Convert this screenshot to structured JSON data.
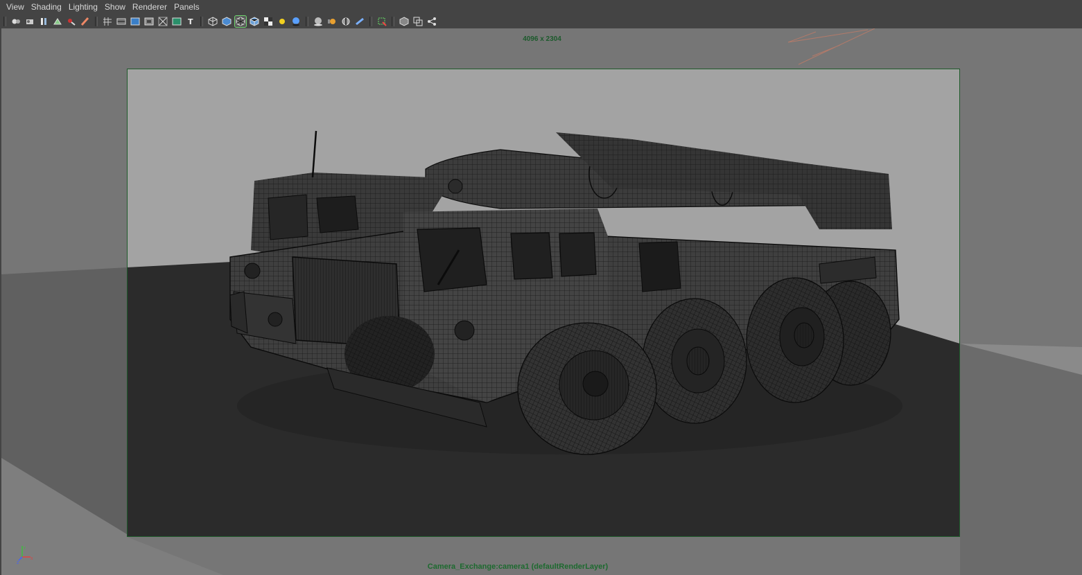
{
  "menu": [
    "View",
    "Shading",
    "Lighting",
    "Show",
    "Renderer",
    "Panels"
  ],
  "toolbar_groups": [
    [
      "camera-select-icon",
      "camera-attributes-icon",
      "bookmark-icon",
      "image-plane-icon",
      "2d-pan-zoom-icon",
      "grease-pencil-icon"
    ],
    [
      "grid-icon",
      "film-gate-icon",
      "resolution-gate-icon",
      "gate-mask-icon",
      "field-chart-icon",
      "safe-action-icon",
      "safe-title-icon"
    ],
    [
      "wireframe-icon",
      "smooth-shade-icon",
      "wireframe-on-shaded-icon",
      "flat-shade-icon",
      "textured-icon",
      "use-all-lights-icon",
      "shadows-icon"
    ],
    [
      "screen-space-ao-icon",
      "motion-blur-icon",
      "depth-of-field-icon",
      "anti-aliasing-icon"
    ],
    [
      "isolate-select-icon"
    ],
    [
      "xray-icon",
      "xray-active-components-icon",
      "xray-joints-icon"
    ]
  ],
  "active_tools": [
    "wireframe-on-shaded-icon"
  ],
  "viewport": {
    "resolution_label": "4096 x 2304",
    "camera_label": "Camera_Exchange:camera1 (defaultRenderLayer)"
  },
  "colors": {
    "ui_background": "#444444",
    "menu_text": "#d8d8d8",
    "gate_border": "#1e5a2a",
    "camera_label": "#1d6a2f",
    "backdrop_gray": "#a3a3a3",
    "floor_dark": "#2b2b2b",
    "wire": "#151515"
  },
  "axis": {
    "x": "X",
    "y": "Y",
    "z": "Z"
  }
}
